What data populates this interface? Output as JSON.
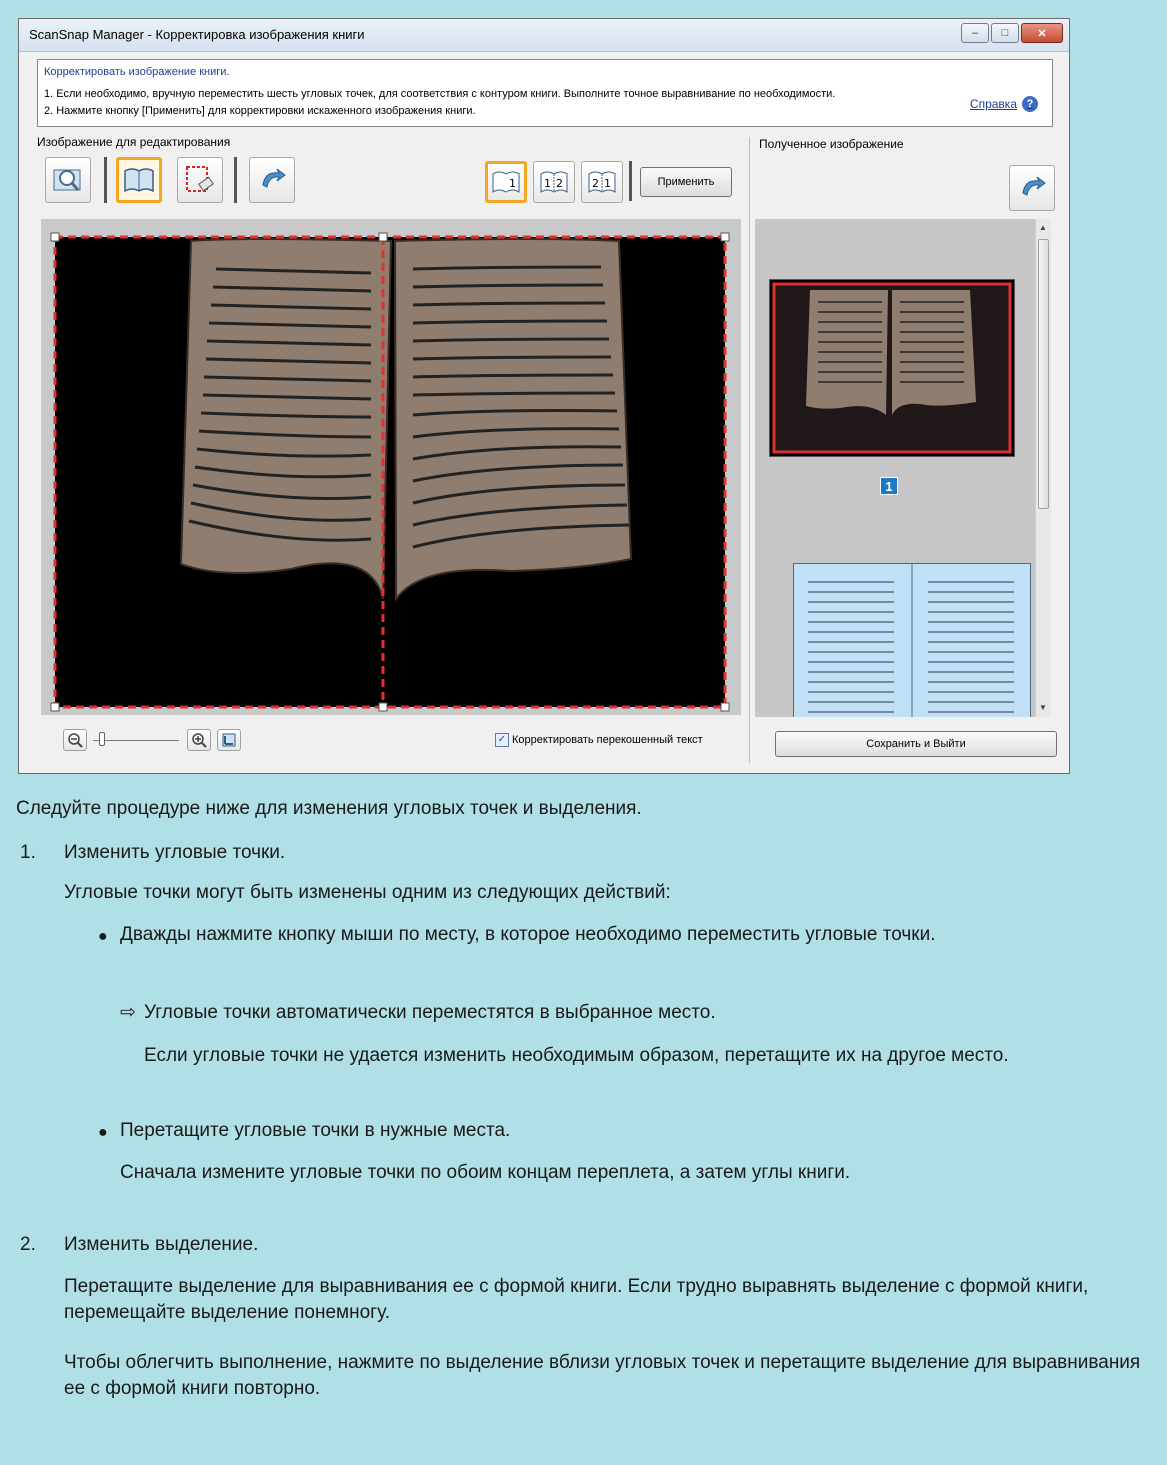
{
  "window": {
    "title": "ScanSnap Manager - Корректировка изображения книги",
    "controls": {
      "minimize": "–",
      "maximize": "□",
      "close": "✕"
    }
  },
  "info": {
    "heading": "Корректировать изображение книги.",
    "line1": "1. Если необходимо, вручную переместить шесть угловых точек, для соответствия с контуром книги. Выполните точное выравнивание по необходимости.",
    "line2": "2. Нажмите кнопку [Применить] для корректировки искаженного изображения книги.",
    "help_label": "Справка",
    "help_icon": "?"
  },
  "left_panel": {
    "label": "Изображение для редактирования",
    "tools": [
      "zoom-icon",
      "book-icon",
      "crop-eraser-icon",
      "undo-icon"
    ],
    "page_modes": [
      {
        "label": "1",
        "active": true
      },
      {
        "label": "12",
        "active": false
      },
      {
        "label": "21",
        "active": false
      }
    ],
    "apply_button": "Применить"
  },
  "right_panel": {
    "label": "Полученное изображение",
    "page_number": "1"
  },
  "bottom": {
    "checkbox_label": "Корректировать перекошенный текст",
    "checkbox_checked": true,
    "save_button": "Сохранить и Выйти",
    "zoom_level": 0.05
  },
  "doc": {
    "intro": "Следуйте процедуре ниже для изменения угловых точек и выделения.",
    "step1_num": "1.",
    "step1_title": "Изменить угловые точки.",
    "step1_desc": "Угловые точки могут быть изменены одним из следующих действий:",
    "bullet1": "Дважды нажмите кнопку мыши по месту, в которое необходимо переместить угловые точки.",
    "arrow_text": "Угловые точки автоматически переместятся в выбранное место.",
    "arrow_note": "Если угловые точки не удается изменить необходимым образом, перетащите их на другое место.",
    "bullet2": "Перетащите угловые точки в нужные места.",
    "bullet2_note": "Сначала измените угловые точки по обоим концам переплета, а затем углы книги.",
    "step2_num": "2.",
    "step2_title": "Изменить выделение.",
    "step2_desc": "Перетащите выделение для выравнивания ее с формой книги. Если трудно выравнять выделение с формой книги, перемещайте выделение понемногу.",
    "step2_note": "Чтобы облегчить выполнение, нажмите по выделение вблизи угловых точек и перетащите выделение для выравнивания ее с формой книги повторно."
  }
}
